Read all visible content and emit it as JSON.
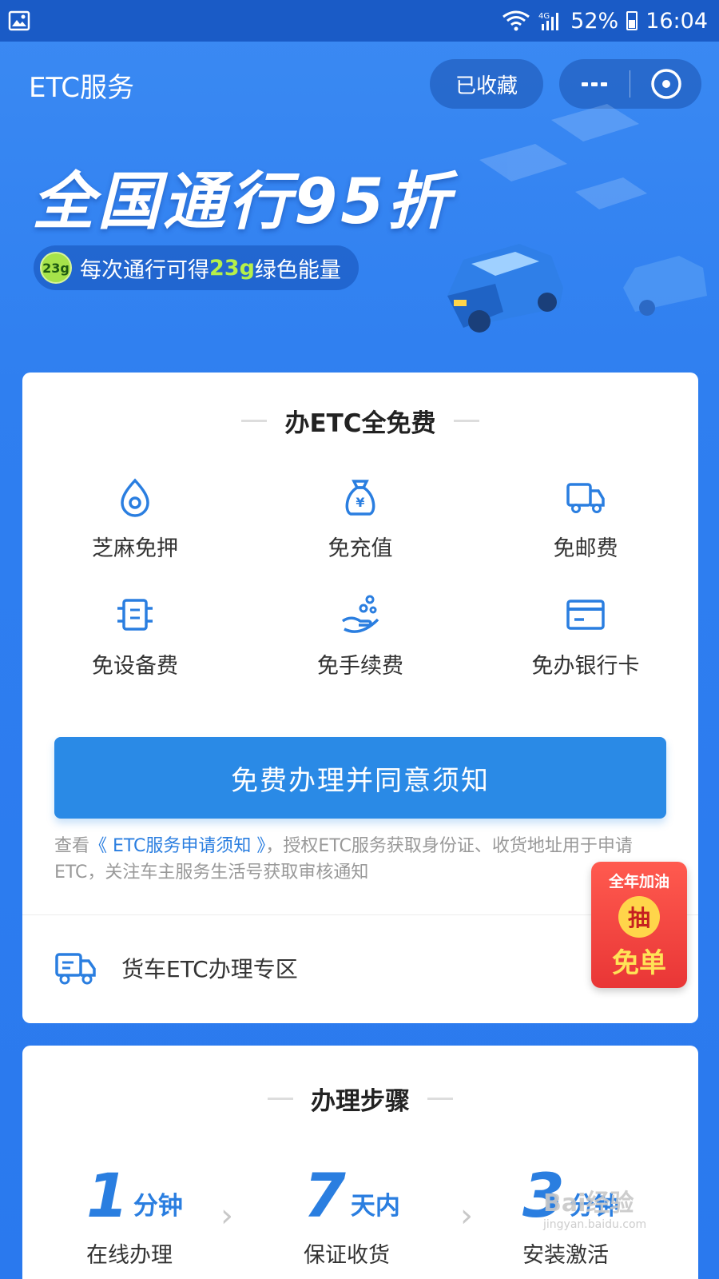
{
  "status_bar": {
    "battery": "52%",
    "time": "16:04",
    "network": "4G"
  },
  "nav": {
    "title": "ETC服务",
    "favorite_label": "已收藏"
  },
  "banner": {
    "headline": "全国通行95折",
    "badge": "23g",
    "energy_prefix": "每次通行可得",
    "energy_amount": "23g",
    "energy_suffix": "绿色能量"
  },
  "free_section": {
    "title": "办ETC全免费",
    "features": [
      {
        "label": "芝麻免押",
        "icon": "sesame-drop-icon"
      },
      {
        "label": "免充值",
        "icon": "money-bag-icon"
      },
      {
        "label": "免邮费",
        "icon": "delivery-truck-icon"
      },
      {
        "label": "免设备费",
        "icon": "device-icon"
      },
      {
        "label": "免手续费",
        "icon": "hand-coins-icon"
      },
      {
        "label": "免办银行卡",
        "icon": "bank-card-icon"
      }
    ],
    "apply_button": "免费办理并同意须知",
    "notice_prefix": "查看",
    "notice_link": "《 ETC服务申请须知 》",
    "notice_suffix": "，授权ETC服务获取身份证、收货地址用于申请ETC，关注车主服务生活号获取审核通知",
    "truck_entry": "货车ETC办理专区"
  },
  "promo": {
    "line1": "全年加油",
    "line2": "抽",
    "line3": "免单"
  },
  "steps_section": {
    "title": "办理步骤",
    "steps": [
      {
        "number": "1",
        "unit": "分钟",
        "desc": "在线办理"
      },
      {
        "number": "7",
        "unit": "天内",
        "desc": "保证收货"
      },
      {
        "number": "3",
        "unit": "分钟",
        "desc": "安装激活"
      }
    ]
  },
  "watermark": {
    "text": "Bai经验",
    "sub": "jingyan.baidu.com"
  },
  "colors": {
    "primary": "#2f80ef",
    "button": "#2a8ae6",
    "accent_green": "#b6f04a",
    "promo_red": "#e93636"
  }
}
